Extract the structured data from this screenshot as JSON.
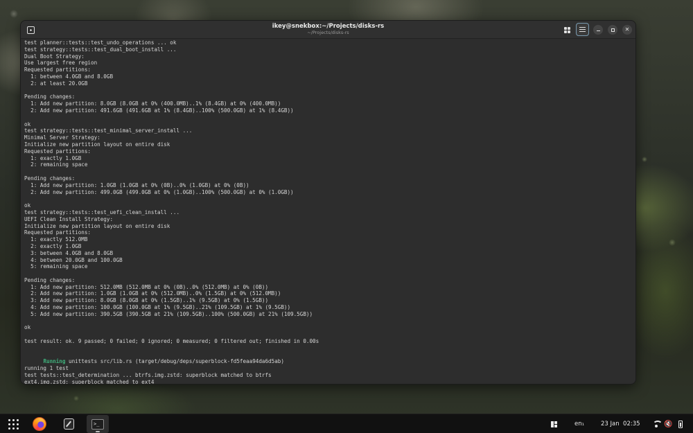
{
  "window": {
    "title": "ikey@snekbox:~/Projects/disks-rs",
    "subtitle": "~/Projects/disks-rs"
  },
  "terminal": {
    "lines": [
      "test planner::tests::test_undo_operations ... ok",
      "test strategy::tests::test_dual_boot_install ...",
      "Dual Boot Strategy:",
      "Use largest free region",
      "Requested partitions:",
      "  1: between 4.0GB and 8.0GB",
      "  2: at least 20.0GB",
      "",
      "Pending changes:",
      "  1: Add new partition: 8.0GB (8.0GB at 0% (400.0MB)..1% (8.4GB) at 0% (400.0MB))",
      "  2: Add new partition: 491.6GB (491.6GB at 1% (8.4GB)..100% (500.0GB) at 1% (8.4GB))",
      "",
      "ok",
      "test strategy::tests::test_minimal_server_install ...",
      "Minimal Server Strategy:",
      "Initialize new partition layout on entire disk",
      "Requested partitions:",
      "  1: exactly 1.0GB",
      "  2: remaining space",
      "",
      "Pending changes:",
      "  1: Add new partition: 1.0GB (1.0GB at 0% (0B)..0% (1.0GB) at 0% (0B))",
      "  2: Add new partition: 499.0GB (499.0GB at 0% (1.0GB)..100% (500.0GB) at 0% (1.0GB))",
      "",
      "ok",
      "test strategy::tests::test_uefi_clean_install ...",
      "UEFI Clean Install Strategy:",
      "Initialize new partition layout on entire disk",
      "Requested partitions:",
      "  1: exactly 512.0MB",
      "  2: exactly 1.0GB",
      "  3: between 4.0GB and 8.0GB",
      "  4: between 20.0GB and 100.0GB",
      "  5: remaining space",
      "",
      "Pending changes:",
      "  1: Add new partition: 512.0MB (512.0MB at 0% (0B)..0% (512.0MB) at 0% (0B))",
      "  2: Add new partition: 1.0GB (1.0GB at 0% (512.0MB)..0% (1.5GB) at 0% (512.0MB))",
      "  3: Add new partition: 8.0GB (8.0GB at 0% (1.5GB)..1% (9.5GB) at 0% (1.5GB))",
      "  4: Add new partition: 100.0GB (100.0GB at 1% (9.5GB)..21% (109.5GB) at 1% (9.5GB))",
      "  5: Add new partition: 390.5GB (390.5GB at 21% (109.5GB)..100% (500.0GB) at 21% (109.5GB))",
      "",
      "ok",
      "",
      "test result: ok. 9 passed; 0 failed; 0 ignored; 0 measured; 0 filtered out; finished in 0.00s",
      "",
      "",
      "",
      "running 1 test",
      "test tests::test_determination ... btrfs.img.zstd: superblock matched to btrfs",
      "ext4.img.zstd: superblock matched to ext4"
    ],
    "running_line": {
      "keyword": "Running",
      "rest": " unittests src/lib.rs (target/debug/deps/superblock-fd5feaa94da6d5ab)"
    }
  },
  "taskbar": {
    "keyboard_layout": "en₁",
    "date": "23 Jan",
    "time": "02:35",
    "apps": [
      {
        "name": "apps-launcher-icon"
      },
      {
        "name": "firefox-icon"
      },
      {
        "name": "text-editor-icon"
      },
      {
        "name": "terminal-icon",
        "glyph": ">_"
      }
    ],
    "volume_glyph": "🔇"
  }
}
